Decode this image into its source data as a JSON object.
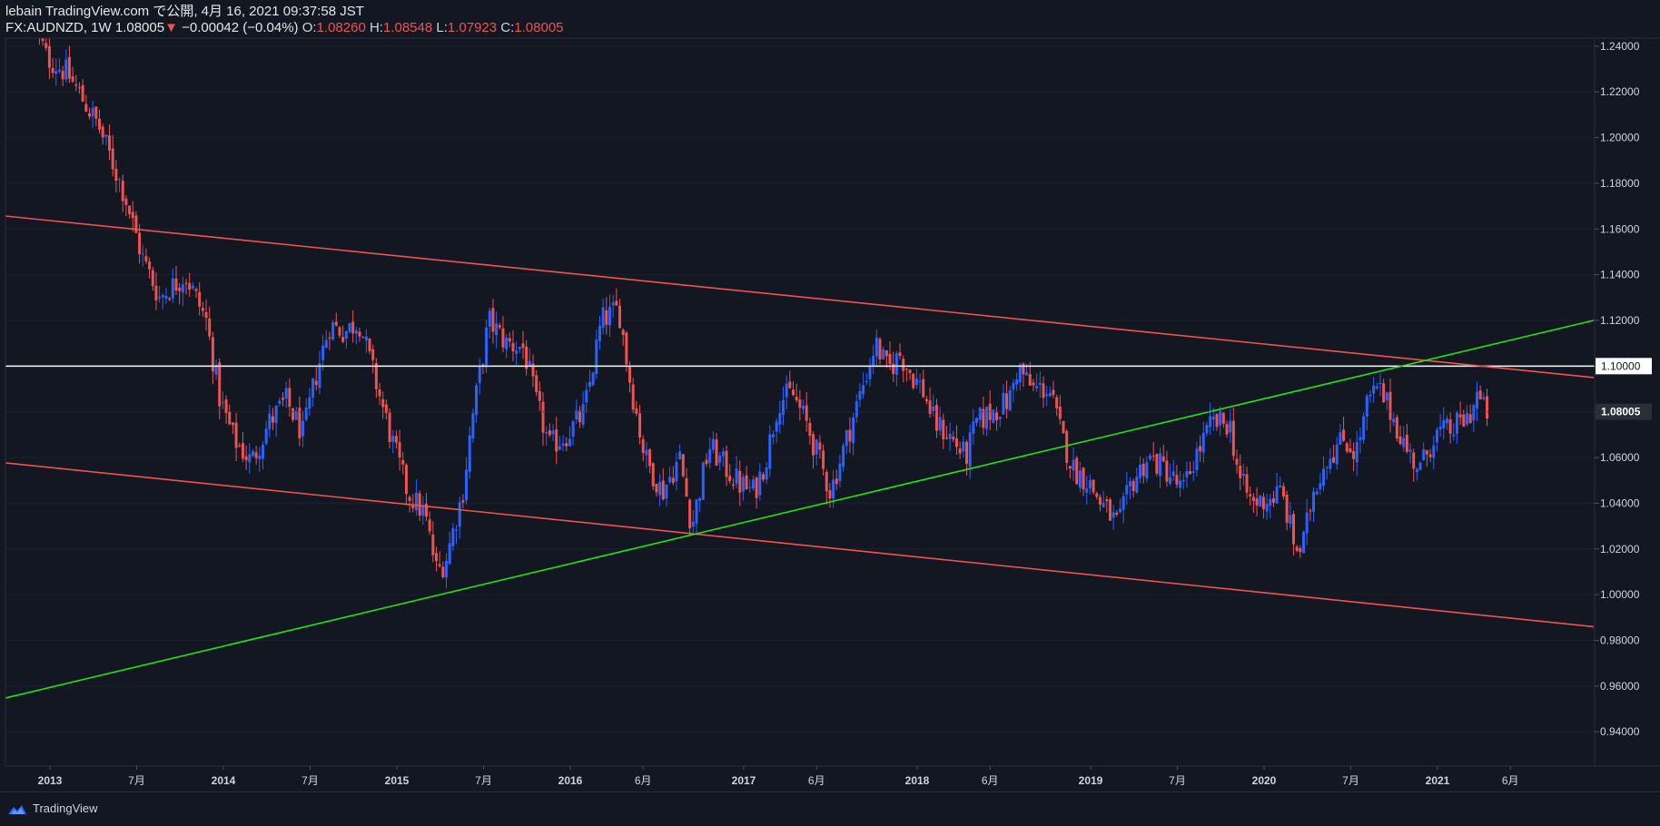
{
  "header": {
    "line1": "lebain TradingView.com で公開, 4月 16, 2021 09:37:58 JST",
    "symbol": "FX:AUDNZD, 1W",
    "last": "1.08005",
    "change": "−0.00042 (−0.04%)",
    "o_label": "O:",
    "o": "1.08260",
    "h_label": "H:",
    "h": "1.08548",
    "l_label": "L:",
    "l": "1.07923",
    "c_label": "C:",
    "c": "1.08005"
  },
  "footer": {
    "brand": "TradingView"
  },
  "colors": {
    "background": "#131722",
    "up": "#2962ff",
    "down": "#ef5350",
    "trend_red": "#f0534f",
    "trend_green": "#21e40f",
    "level": "#ffffff"
  },
  "chart_data": {
    "type": "candlestick",
    "symbol": "FX:AUDNZD",
    "interval": "1W",
    "ylim": [
      0.925,
      1.2435
    ],
    "y_ticks": [
      "1.24000",
      "1.22000",
      "1.20000",
      "1.18000",
      "1.16000",
      "1.14000",
      "1.12000",
      "1.10000",
      "1.08000",
      "1.06000",
      "1.04000",
      "1.02000",
      "1.00000",
      "0.98000",
      "0.96000",
      "0.94000"
    ],
    "x_ticks": [
      {
        "label": "2013",
        "t": 2013.0
      },
      {
        "label": "7月",
        "t": 2013.5
      },
      {
        "label": "2014",
        "t": 2014.0
      },
      {
        "label": "7月",
        "t": 2014.5
      },
      {
        "label": "2015",
        "t": 2015.0
      },
      {
        "label": "7月",
        "t": 2015.5
      },
      {
        "label": "2016",
        "t": 2016.0
      },
      {
        "label": "6月",
        "t": 2016.42
      },
      {
        "label": "2017",
        "t": 2017.0
      },
      {
        "label": "6月",
        "t": 2017.42
      },
      {
        "label": "2018",
        "t": 2018.0
      },
      {
        "label": "6月",
        "t": 2018.42
      },
      {
        "label": "2019",
        "t": 2019.0
      },
      {
        "label": "7月",
        "t": 2019.5
      },
      {
        "label": "2020",
        "t": 2020.0
      },
      {
        "label": "7月",
        "t": 2020.5
      },
      {
        "label": "2021",
        "t": 2021.0
      },
      {
        "label": "6月",
        "t": 2021.42
      }
    ],
    "price_key": [
      [
        2012.92,
        1.252
      ],
      [
        2013.0,
        1.235
      ],
      [
        2013.12,
        1.228
      ],
      [
        2013.3,
        1.205
      ],
      [
        2013.45,
        1.175
      ],
      [
        2013.55,
        1.148
      ],
      [
        2013.65,
        1.13
      ],
      [
        2013.8,
        1.14
      ],
      [
        2013.92,
        1.12
      ],
      [
        2014.0,
        1.085
      ],
      [
        2014.08,
        1.068
      ],
      [
        2014.18,
        1.058
      ],
      [
        2014.28,
        1.075
      ],
      [
        2014.38,
        1.085
      ],
      [
        2014.48,
        1.07
      ],
      [
        2014.55,
        1.095
      ],
      [
        2014.63,
        1.118
      ],
      [
        2014.72,
        1.115
      ],
      [
        2014.8,
        1.12
      ],
      [
        2014.88,
        1.098
      ],
      [
        2015.0,
        1.065
      ],
      [
        2015.08,
        1.045
      ],
      [
        2015.18,
        1.035
      ],
      [
        2015.25,
        1.01
      ],
      [
        2015.3,
        1.015
      ],
      [
        2015.4,
        1.045
      ],
      [
        2015.45,
        1.075
      ],
      [
        2015.55,
        1.12
      ],
      [
        2015.65,
        1.11
      ],
      [
        2015.75,
        1.108
      ],
      [
        2015.82,
        1.085
      ],
      [
        2015.9,
        1.065
      ],
      [
        2016.0,
        1.07
      ],
      [
        2016.1,
        1.08
      ],
      [
        2016.2,
        1.12
      ],
      [
        2016.3,
        1.125
      ],
      [
        2016.36,
        1.095
      ],
      [
        2016.45,
        1.06
      ],
      [
        2016.55,
        1.045
      ],
      [
        2016.65,
        1.06
      ],
      [
        2016.72,
        1.03
      ],
      [
        2016.82,
        1.065
      ],
      [
        2016.92,
        1.055
      ],
      [
        2017.0,
        1.048
      ],
      [
        2017.08,
        1.045
      ],
      [
        2017.15,
        1.06
      ],
      [
        2017.22,
        1.085
      ],
      [
        2017.3,
        1.088
      ],
      [
        2017.38,
        1.075
      ],
      [
        2017.45,
        1.06
      ],
      [
        2017.52,
        1.045
      ],
      [
        2017.6,
        1.065
      ],
      [
        2017.7,
        1.09
      ],
      [
        2017.78,
        1.11
      ],
      [
        2017.85,
        1.098
      ],
      [
        2017.92,
        1.105
      ],
      [
        2018.0,
        1.095
      ],
      [
        2018.05,
        1.09
      ],
      [
        2018.12,
        1.075
      ],
      [
        2018.2,
        1.07
      ],
      [
        2018.3,
        1.06
      ],
      [
        2018.36,
        1.075
      ],
      [
        2018.45,
        1.08
      ],
      [
        2018.55,
        1.085
      ],
      [
        2018.6,
        1.1
      ],
      [
        2018.68,
        1.09
      ],
      [
        2018.78,
        1.09
      ],
      [
        2018.85,
        1.07
      ],
      [
        2018.92,
        1.055
      ],
      [
        2019.0,
        1.05
      ],
      [
        2019.08,
        1.04
      ],
      [
        2019.18,
        1.03
      ],
      [
        2019.25,
        1.048
      ],
      [
        2019.35,
        1.06
      ],
      [
        2019.45,
        1.055
      ],
      [
        2019.55,
        1.045
      ],
      [
        2019.62,
        1.06
      ],
      [
        2019.72,
        1.075
      ],
      [
        2019.82,
        1.075
      ],
      [
        2019.88,
        1.05
      ],
      [
        2019.95,
        1.04
      ],
      [
        2020.05,
        1.042
      ],
      [
        2020.12,
        1.045
      ],
      [
        2020.2,
        1.02
      ],
      [
        2020.24,
        1.02
      ],
      [
        2020.3,
        1.045
      ],
      [
        2020.38,
        1.06
      ],
      [
        2020.48,
        1.068
      ],
      [
        2020.55,
        1.062
      ],
      [
        2020.62,
        1.085
      ],
      [
        2020.68,
        1.09
      ],
      [
        2020.75,
        1.08
      ],
      [
        2020.85,
        1.062
      ],
      [
        2020.92,
        1.055
      ],
      [
        2021.0,
        1.07
      ],
      [
        2021.1,
        1.072
      ],
      [
        2021.2,
        1.078
      ],
      [
        2021.25,
        1.088
      ],
      [
        2021.29,
        1.08
      ]
    ],
    "last_price": 1.08005,
    "horizontal_line": 1.1,
    "trendlines": [
      {
        "color": "red",
        "points": [
          [
            2012.7,
            1.166
          ],
          [
            2021.9,
            1.095
          ]
        ]
      },
      {
        "color": "red",
        "points": [
          [
            2012.7,
            1.058
          ],
          [
            2021.9,
            0.986
          ]
        ]
      },
      {
        "color": "green",
        "points": [
          [
            2012.7,
            0.954
          ],
          [
            2021.9,
            1.12
          ]
        ]
      }
    ]
  }
}
